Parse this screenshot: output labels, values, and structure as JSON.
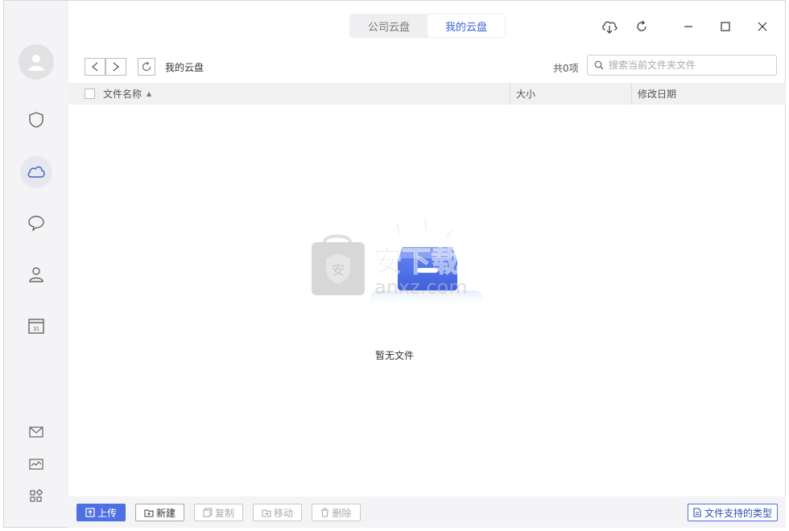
{
  "top_tabs": [
    {
      "label": "公司云盘",
      "active": false
    },
    {
      "label": "我的云盘",
      "active": true
    }
  ],
  "window_controls": {
    "download_icon": "cloud-download-icon",
    "refresh_icon": "refresh-icon",
    "minimize_icon": "minimize-icon",
    "maximize_icon": "maximize-icon",
    "close_icon": "close-icon"
  },
  "sidebar": {
    "avatar_icon": "user-avatar-icon",
    "items": [
      {
        "name": "shield-icon"
      },
      {
        "name": "cloud-icon",
        "active": true
      },
      {
        "name": "chat-bubble-icon"
      },
      {
        "name": "contacts-icon"
      },
      {
        "name": "calendar-icon",
        "text": "31"
      }
    ],
    "bottom_items": [
      {
        "name": "mail-icon"
      },
      {
        "name": "chart-icon"
      },
      {
        "name": "apps-grid-icon"
      }
    ]
  },
  "toolbar": {
    "breadcrumb": "我的云盘",
    "count": "共0项",
    "search_placeholder": "搜索当前文件夹文件"
  },
  "table": {
    "columns": [
      "文件名称",
      "大小",
      "修改日期"
    ],
    "sort_indicator": "▲"
  },
  "empty_state": {
    "text": "暂无文件"
  },
  "watermark": {
    "text": "安下载",
    "sub": "anxz.com",
    "badge": "安"
  },
  "bottom_bar": {
    "upload": "上传",
    "new": "新建",
    "copy": "复制",
    "move": "移动",
    "delete": "删除",
    "supported_types": "文件支持的类型"
  },
  "colors": {
    "accent": "#4f70e3",
    "active_tab_text": "#3b63d6"
  }
}
